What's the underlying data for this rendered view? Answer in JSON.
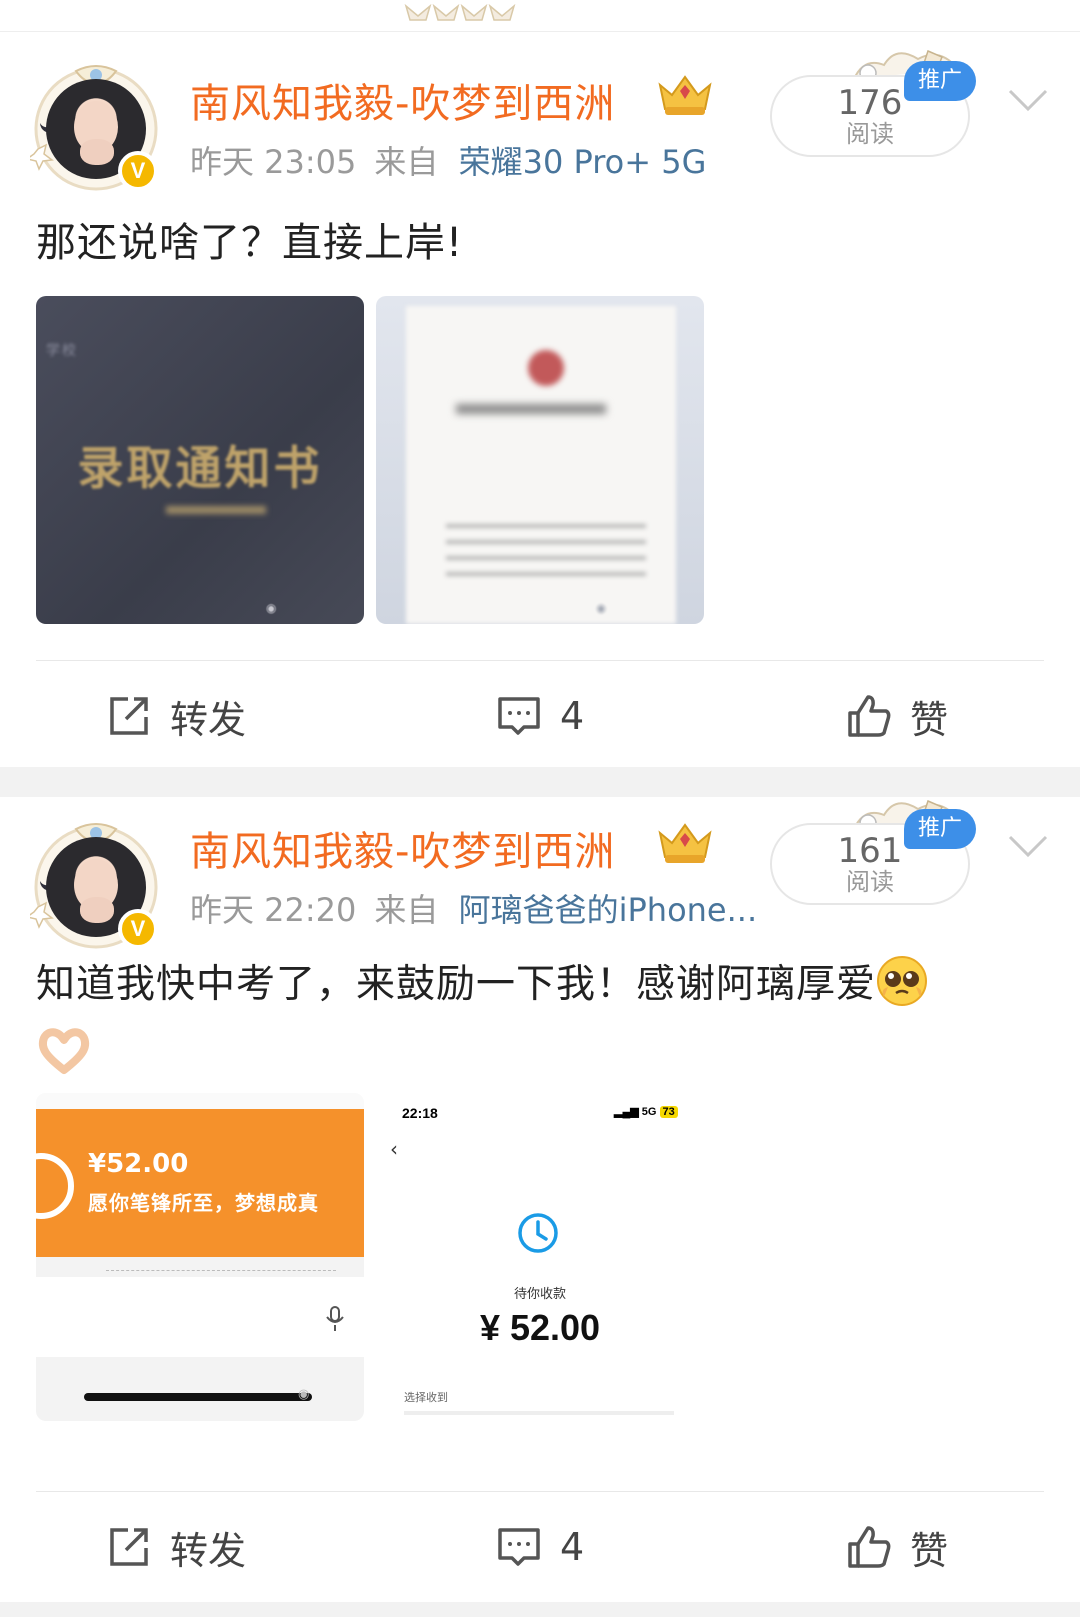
{
  "colors": {
    "username": "#f26b21",
    "source_link": "#49759b",
    "promo_badge": "#3d8fe8",
    "page_gap": "#f2f2f2"
  },
  "posts": [
    {
      "username": "南风知我毅-吹梦到西洲",
      "time": "昨天 23:05",
      "from_label": "来自",
      "source": "荣耀30 Pro+ 5G",
      "reads": "176",
      "reads_label": "阅读",
      "promo": "推广",
      "text": "那还说啥了？直接上岸!",
      "images": [
        {
          "title": "录取通知书",
          "school": "学校"
        },
        {}
      ],
      "actions": {
        "repost": "转发",
        "comments": "4",
        "like": "赞"
      }
    },
    {
      "username": "南风知我毅-吹梦到西洲",
      "time": "昨天 22:20",
      "from_label": "来自",
      "source": "阿璃爸爸的iPhone...",
      "reads": "161",
      "reads_label": "阅读",
      "promo": "推广",
      "text_line1": "知道我快中考了，来鼓励一下我！感谢阿璃厚爱",
      "images": [
        {
          "amount": "¥52.00",
          "wish": "愿你笔锋所至，梦想成真"
        },
        {
          "time": "22:18",
          "signal": "5G",
          "battery": "73",
          "pending": "待你收款",
          "money": "¥ 52.00",
          "select": "选择收到"
        }
      ],
      "actions": {
        "repost": "转发",
        "comments": "4",
        "like": "赞"
      }
    }
  ],
  "icons": [
    "avatar-frame-icon",
    "verified-v-icon",
    "crown-icon",
    "chevron-down-icon",
    "repost-icon",
    "comment-icon",
    "like-icon",
    "pleading-face-emoji",
    "heart-hands-emoji",
    "clock-icon",
    "mic-icon"
  ]
}
